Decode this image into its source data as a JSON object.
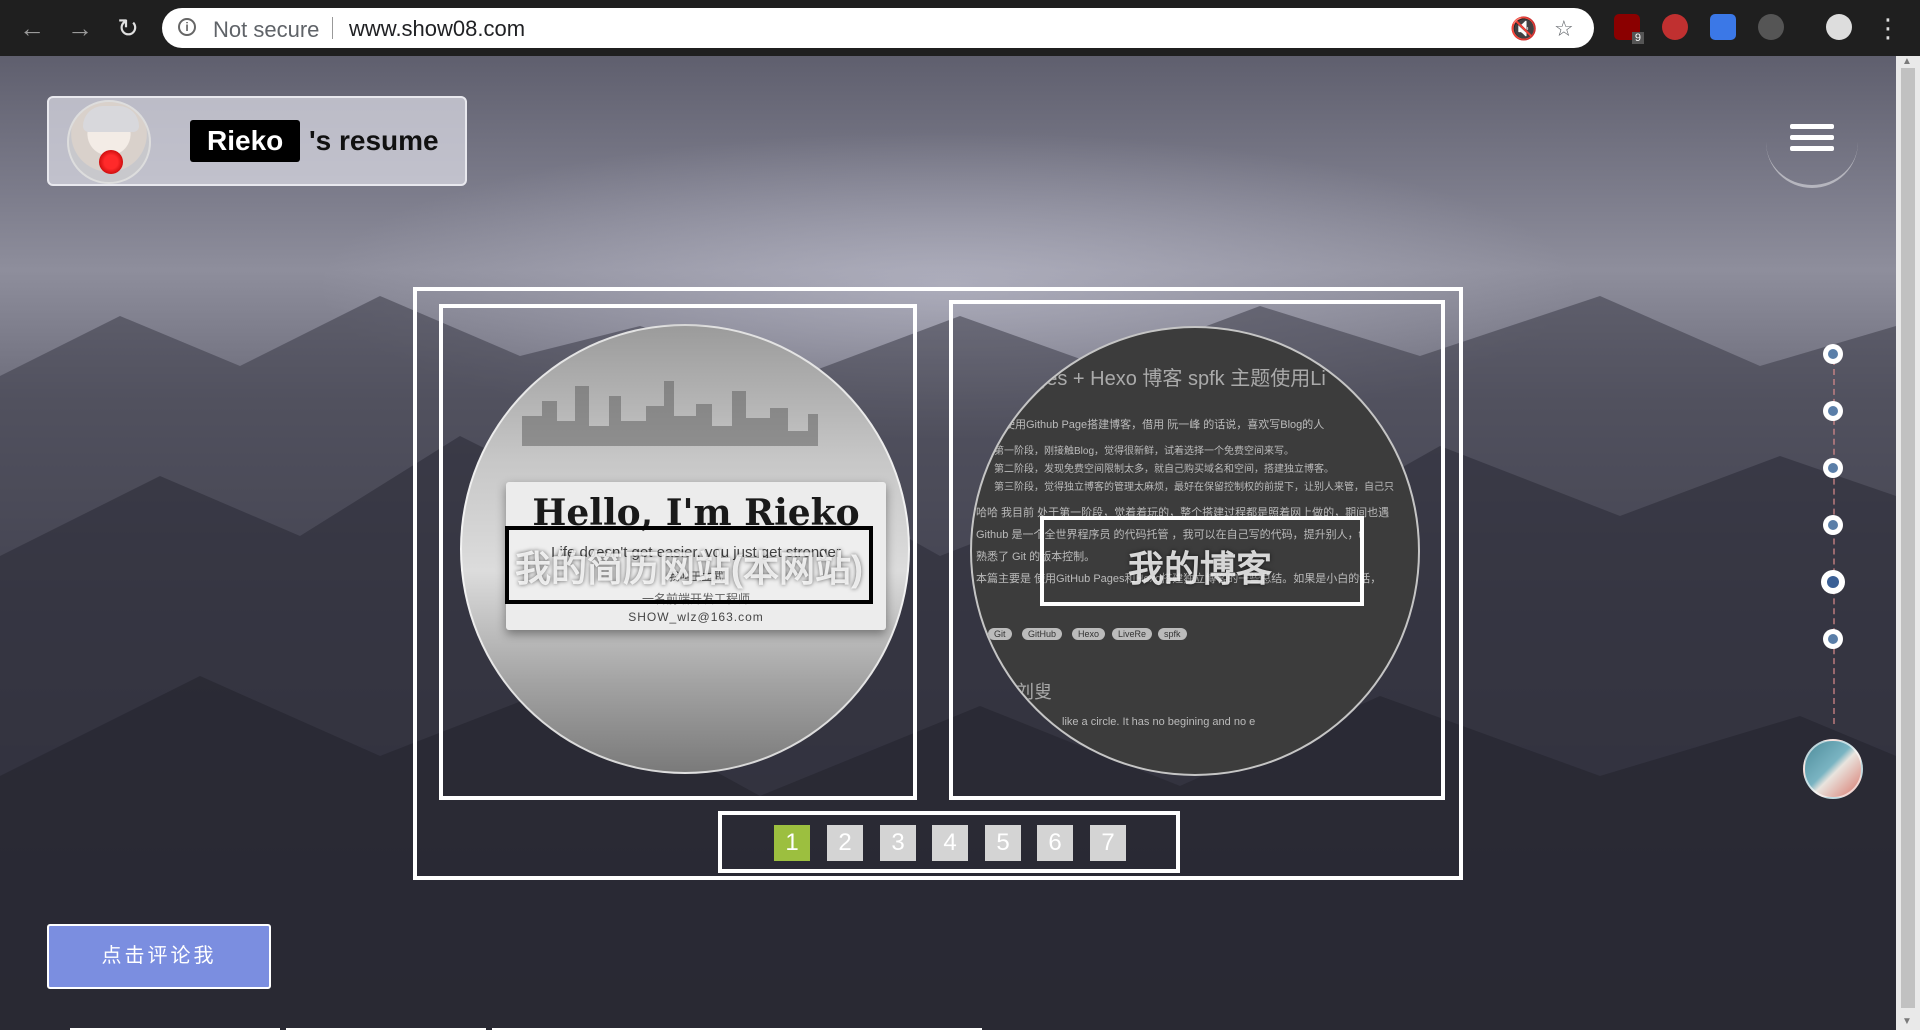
{
  "browser": {
    "security_label": "Not secure",
    "url": "www.show08.com",
    "ext_badge": "9"
  },
  "header": {
    "name": "Rieko",
    "suffix": "'s resume"
  },
  "showcase": {
    "cards": [
      {
        "overlay_label": "我的简历网站(本网站)",
        "hello": "Hello, I'm Rieko",
        "quote": "Life doesn't get easier, you just get stronger",
        "line1": "我叫王立武",
        "line2": "一名前端开发工程师",
        "email": "SHOW_wlz@163.com"
      },
      {
        "overlay_label": "我的博客",
        "title": "ages + Hexo 博客 spfk 主题使用Li",
        "lines": [
          "使用Github Page搭建博客，借用 阮一峰 的话说，喜欢写Blog的人",
          "第一阶段，刚接触Blog，觉得很新鲜，试着选择一个免费空间来写。",
          "第二阶段，发现免费空间限制太多，就自己购买域名和空间，搭建独立博客。",
          "第三阶段，觉得独立博客的管理太麻烦，最好在保留控制权的前提下，让别人来管，自己只",
          "哈哈 我目前 处于第一阶段，觉着着玩的，整个搭建过程都是照着网上做的，期间也遇",
          "Github 是一个全世界程序员 的代码托管 ，我可以在自己写的代码，提升别人，t",
          "熟悉了 Git 的版本控制。",
          "本篇主要是 使用GitHub Pages和Hexo搭建独立博客的一些总结。如果是小白的话，"
        ],
        "tags": [
          "Git",
          "GitHub",
          "Hexo",
          "LiveRe",
          "spfk"
        ],
        "footer_title": "刘叟",
        "footer_text": "like a circle. It has no begining and no e"
      }
    ],
    "pages": [
      "1",
      "2",
      "3",
      "4",
      "5",
      "6",
      "7"
    ],
    "active_page": "1"
  },
  "comment_button": "点击评论我",
  "colors": {
    "accent_green": "#9cbf3f",
    "button_blue": "#7b8ee0"
  }
}
